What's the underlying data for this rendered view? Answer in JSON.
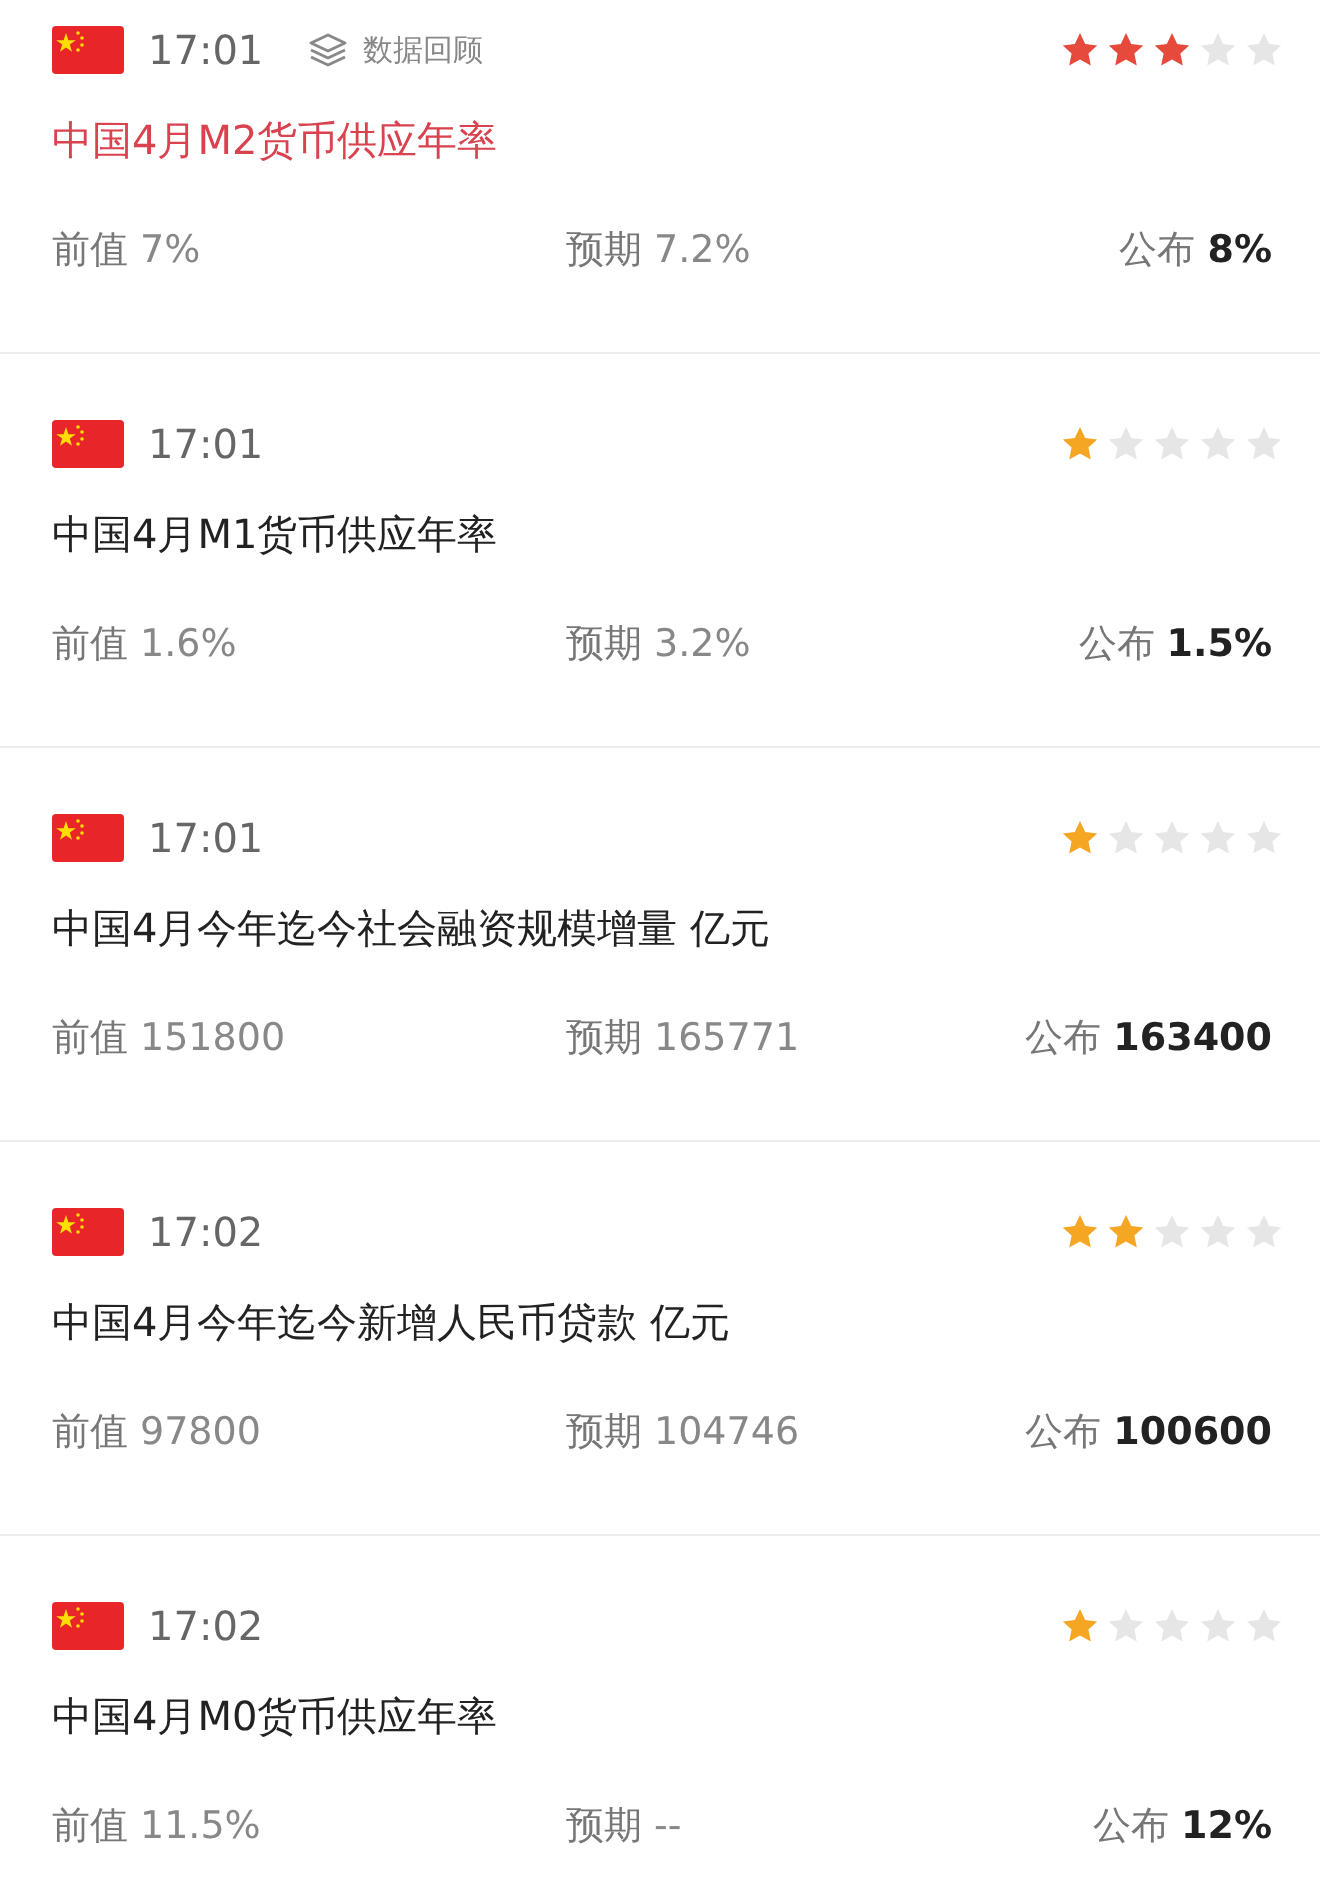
{
  "events": [
    {
      "time": "17:01",
      "review_label": "数据回顾",
      "stars": 3,
      "color": "#e64a3c",
      "highlighted": true,
      "title": "中国4月M2货币供应年率",
      "previous": {
        "label": "前值",
        "value": "7%"
      },
      "forecast": {
        "label": "预期",
        "value": "7.2%"
      },
      "actual": {
        "label": "公布",
        "value": "8%"
      }
    },
    {
      "time": "17:01",
      "stars": 1,
      "color": "#f5a623",
      "highlighted": false,
      "title": "中国4月M1货币供应年率",
      "previous": {
        "label": "前值",
        "value": "1.6%"
      },
      "forecast": {
        "label": "预期",
        "value": "3.2%"
      },
      "actual": {
        "label": "公布",
        "value": "1.5%"
      }
    },
    {
      "time": "17:01",
      "stars": 1,
      "color": "#f5a623",
      "highlighted": false,
      "title": "中国4月今年迄今社会融资规模增量 亿元",
      "previous": {
        "label": "前值",
        "value": "151800"
      },
      "forecast": {
        "label": "预期",
        "value": "165771"
      },
      "actual": {
        "label": "公布",
        "value": "163400"
      }
    },
    {
      "time": "17:02",
      "stars": 2,
      "color": "#f5a623",
      "highlighted": false,
      "title": "中国4月今年迄今新增人民币贷款 亿元",
      "previous": {
        "label": "前值",
        "value": "97800"
      },
      "forecast": {
        "label": "预期",
        "value": "104746"
      },
      "actual": {
        "label": "公布",
        "value": "100600"
      }
    },
    {
      "time": "17:02",
      "stars": 1,
      "color": "#f5a623",
      "highlighted": false,
      "title": "中国4月M0货币供应年率",
      "previous": {
        "label": "前值",
        "value": "11.5%"
      },
      "forecast": {
        "label": "预期",
        "value": "--"
      },
      "actual": {
        "label": "公布",
        "value": "12%"
      }
    }
  ]
}
